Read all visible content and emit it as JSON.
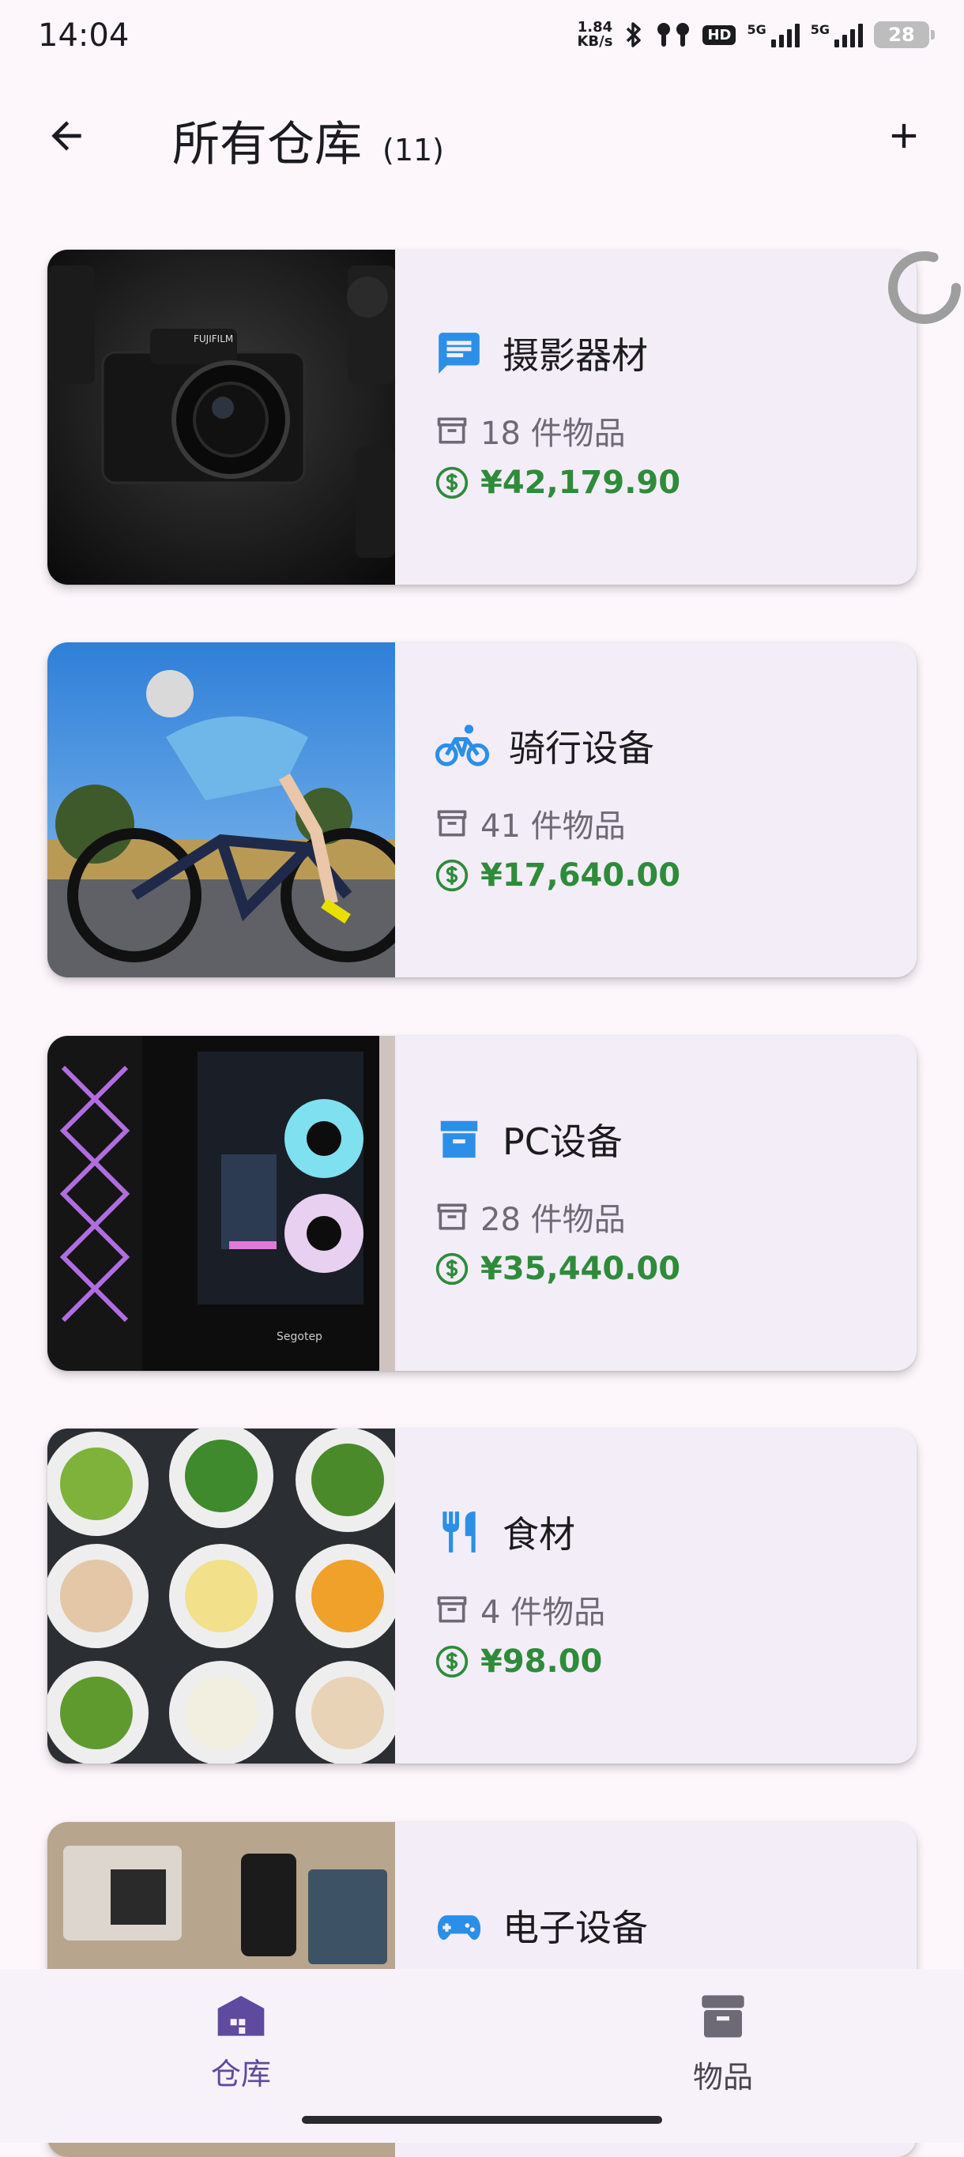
{
  "status_bar": {
    "time": "14:04",
    "net_speed_value": "1.84",
    "net_speed_unit": "KB/s",
    "hd_badge": "HD",
    "signal1_label": "5G",
    "signal2_label": "5G",
    "battery_level": "28"
  },
  "app_bar": {
    "title": "所有仓库",
    "count": "(11)",
    "back_icon": "arrow-left",
    "add_icon": "plus"
  },
  "warehouses": [
    {
      "name": "摄影器材",
      "icon": "message-icon",
      "icon_color": "#2B8FE8",
      "items": "18 件物品",
      "value": "¥42,179.90",
      "image": "camera-photo"
    },
    {
      "name": "骑行设备",
      "icon": "bicycle-icon",
      "icon_color": "#2B8FE8",
      "items": "41 件物品",
      "value": "¥17,640.00",
      "image": "cyclist-photo"
    },
    {
      "name": "PC设备",
      "icon": "archive-icon",
      "icon_color": "#2B8FE8",
      "items": "28 件物品",
      "value": "¥35,440.00",
      "image": "pc-case-photo"
    },
    {
      "name": "食材",
      "icon": "utensils-icon",
      "icon_color": "#2B8FE8",
      "items": "4 件物品",
      "value": "¥98.00",
      "image": "food-photo"
    },
    {
      "name": "电子设备",
      "icon": "gamepad-icon",
      "icon_color": "#2B8FE8",
      "items": "",
      "value": "",
      "image": "electronics-photo"
    }
  ],
  "bottom_nav": {
    "items": [
      {
        "label": "仓库",
        "icon": "warehouse-icon",
        "active": true
      },
      {
        "label": "物品",
        "icon": "archive-icon",
        "active": false
      }
    ]
  },
  "colors": {
    "accent": "#2B8FE8",
    "value_green": "#2E8B3A",
    "nav_active": "#5E4A9E",
    "background": "#FDF7FC",
    "card": "#F3EDF7"
  }
}
